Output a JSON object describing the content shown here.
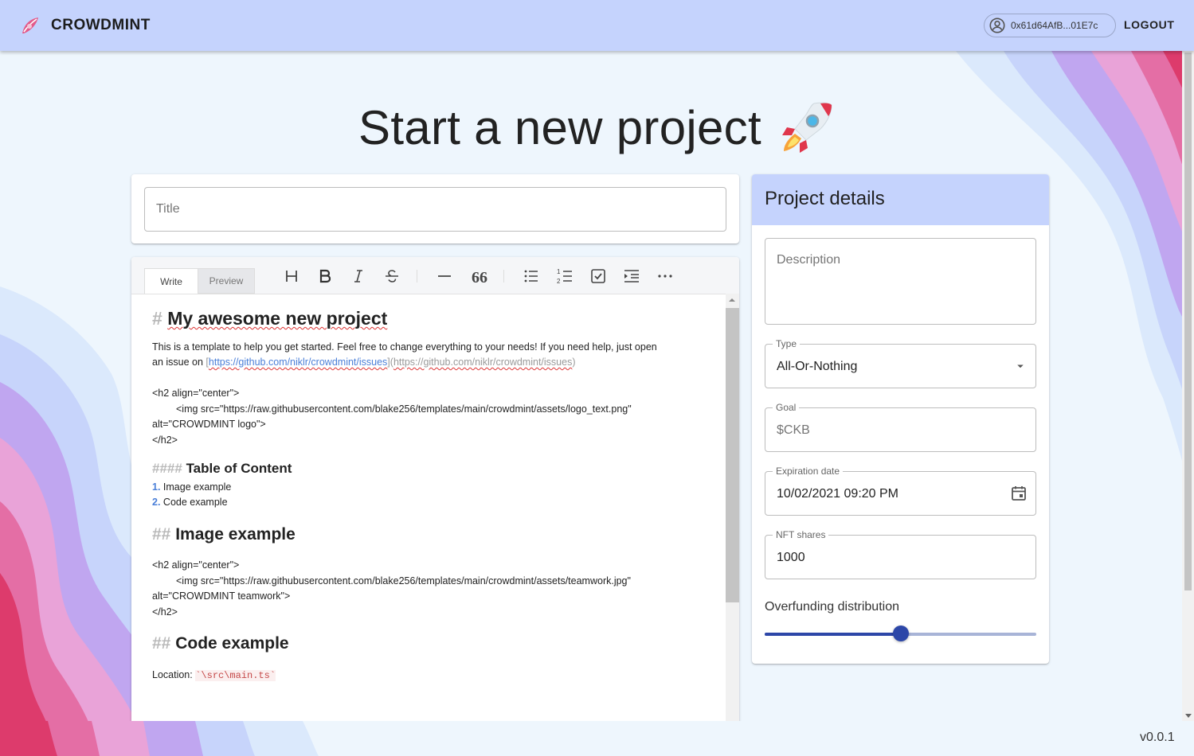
{
  "appbar": {
    "brand": "CROWDMINT",
    "wallet": "0x61d64AfB...01E7c",
    "logout_label": "LOGOUT"
  },
  "page": {
    "title": "Start a new project"
  },
  "title_field": {
    "placeholder": "Title"
  },
  "editor": {
    "tabs": [
      "Write",
      "Preview"
    ],
    "toolbar_icons": [
      "heading-icon",
      "bold-icon",
      "italic-icon",
      "strikethrough-icon",
      "horizontal-rule-icon",
      "quote-icon",
      "unordered-list-icon",
      "ordered-list-icon",
      "checklist-icon",
      "indent-icon",
      "more-icon"
    ],
    "lines": {
      "h1_mark": "#",
      "h1": "My awesome new project",
      "p1": "This is a template to help you get started. Feel free to change everything to your needs! If you need help, just open",
      "p1b": "an issue on",
      "link_text": "https://github.com/niklr/crowdmint/issues",
      "link_url": "https://github.com/niklr/crowdmint/issues",
      "h2a_open": "<h2 align=\"center\">",
      "img1": "<img src=\"https://raw.githubusercontent.com/blake256/templates/main/crowdmint/assets/logo_text.png\"",
      "img1_alt": "alt=\"CROWDMINT logo\">",
      "h2_close": "</h2>",
      "h4_mark": "####",
      "h4": "Table of Content",
      "toc": [
        {
          "num": "1.",
          "text": "Image example"
        },
        {
          "num": "2.",
          "text": "Code example"
        }
      ],
      "h2_mark": "##",
      "h2_image": "Image example",
      "img2": "<img src=\"https://raw.githubusercontent.com/blake256/templates/main/crowdmint/assets/teamwork.jpg\"",
      "img2_alt": "alt=\"CROWDMINT teamwork\">",
      "h2_code": "Code example",
      "location_label": "Location:",
      "location_code": "`\\src\\main.ts`"
    }
  },
  "details": {
    "title": "Project details",
    "description_placeholder": "Description",
    "type_label": "Type",
    "type_value": "All-Or-Nothing",
    "goal_label": "Goal",
    "goal_placeholder": "$CKB",
    "expiration_label": "Expiration date",
    "expiration_value": "10/02/2021 09:20 PM",
    "nft_label": "NFT shares",
    "nft_value": "1000",
    "overfunding_label": "Overfunding distribution",
    "overfunding_fraction": 0.5
  },
  "footer": {
    "version": "v0.0.1"
  },
  "colors": {
    "appbar": "#c5d3fd",
    "accent": "#2d47a8"
  }
}
